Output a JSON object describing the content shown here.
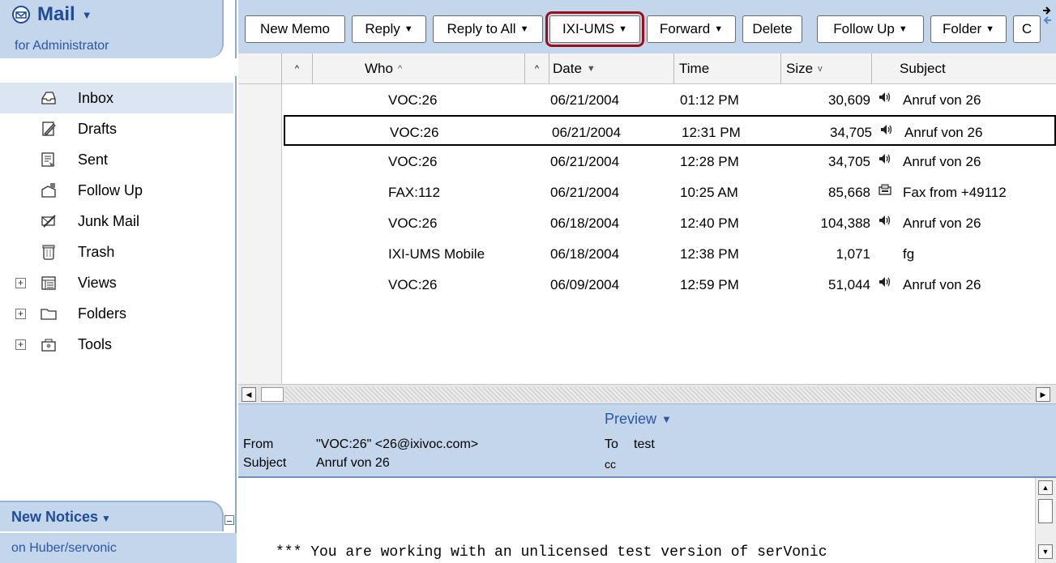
{
  "sidebar": {
    "title": "Mail",
    "subtitle": "for Administrator",
    "items": [
      {
        "label": "Inbox",
        "icon": "inbox-icon",
        "selected": true
      },
      {
        "label": "Drafts",
        "icon": "drafts-icon"
      },
      {
        "label": "Sent",
        "icon": "sent-icon"
      },
      {
        "label": "Follow Up",
        "icon": "follow-up-icon"
      },
      {
        "label": "Junk Mail",
        "icon": "junk-mail-icon"
      },
      {
        "label": "Trash",
        "icon": "trash-icon"
      },
      {
        "label": "Views",
        "icon": "views-icon",
        "expandable": true
      },
      {
        "label": "Folders",
        "icon": "folder-icon",
        "expandable": true
      },
      {
        "label": "Tools",
        "icon": "tools-icon",
        "expandable": true
      }
    ],
    "notices_title": "New Notices",
    "notices_sub": "on Huber/servonic"
  },
  "toolbar": {
    "buttons": [
      {
        "label": "New Memo",
        "dropdown": false
      },
      {
        "label": "Reply",
        "dropdown": true
      },
      {
        "label": "Reply to All",
        "dropdown": true
      },
      {
        "label": "IXI-UMS",
        "dropdown": true,
        "highlighted": true
      },
      {
        "label": "Forward",
        "dropdown": true
      },
      {
        "label": "Delete",
        "dropdown": false
      },
      {
        "label": "Follow Up",
        "dropdown": true
      },
      {
        "label": "Folder",
        "dropdown": true
      },
      {
        "label": "C",
        "dropdown": false
      }
    ]
  },
  "columns": {
    "who": "Who",
    "date": "Date",
    "time": "Time",
    "size": "Size",
    "subject": "Subject"
  },
  "messages": [
    {
      "who": "VOC:26",
      "date": "06/21/2004",
      "time": "01:12 PM",
      "size": "30,609",
      "type": "voice",
      "subject": "Anruf von 26"
    },
    {
      "who": "VOC:26",
      "date": "06/21/2004",
      "time": "12:31 PM",
      "size": "34,705",
      "type": "voice",
      "subject": "Anruf von 26",
      "focused": true
    },
    {
      "who": "VOC:26",
      "date": "06/21/2004",
      "time": "12:28 PM",
      "size": "34,705",
      "type": "voice",
      "subject": "Anruf von 26"
    },
    {
      "who": "FAX:112",
      "date": "06/21/2004",
      "time": "10:25 AM",
      "size": "85,668",
      "type": "fax",
      "subject": "Fax from +49112"
    },
    {
      "who": "VOC:26",
      "date": "06/18/2004",
      "time": "12:40 PM",
      "size": "104,388",
      "type": "voice",
      "subject": "Anruf von 26"
    },
    {
      "who": "IXI-UMS Mobile",
      "date": "06/18/2004",
      "time": "12:38 PM",
      "size": "1,071",
      "type": "",
      "subject": "fg"
    },
    {
      "who": "VOC:26",
      "date": "06/09/2004",
      "time": "12:59 PM",
      "size": "51,044",
      "type": "voice",
      "subject": "Anruf von 26"
    }
  ],
  "preview": {
    "title": "Preview",
    "from_label": "From",
    "from_value": "\"VOC:26\" <26@ixivoc.com>",
    "to_label": "To",
    "to_value": "test",
    "subject_label": "Subject",
    "subject_value": "Anruf von 26",
    "cc_label": "cc",
    "body": "*** You are working with an unlicensed test version of serVonic"
  },
  "colors": {
    "panel_blue": "#c4d6ec",
    "header_text": "#1f4b99",
    "highlight_border": "#9b0e16"
  }
}
